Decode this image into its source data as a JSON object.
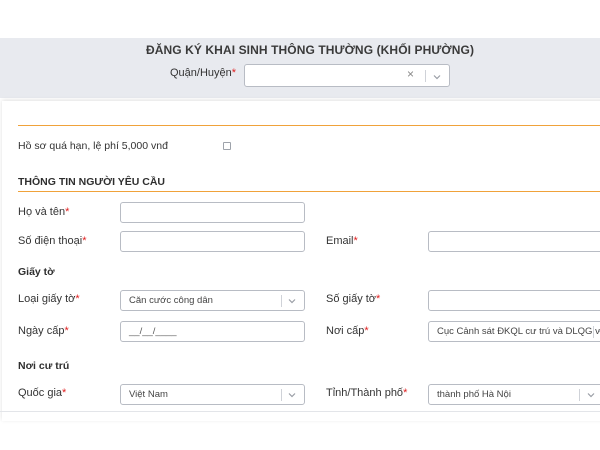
{
  "header": {
    "title": "ĐĂNG KÝ KHAI SINH THÔNG THƯỜNG (KHỐI PHƯỜNG)",
    "district_label": "Quận/Huyện",
    "district_value": "",
    "clear_glyph": "×"
  },
  "form": {
    "late_fee_label": "Hồ sơ quá hạn, lệ phí 5,000 vnđ",
    "requester_section": "THÔNG TIN NGƯỜI YÊU CẦU",
    "full_name_label": "Họ và tên",
    "phone_label": "Số điện thoại",
    "email_label": "Email",
    "documents_section": "Giấy tờ",
    "doc_type_label": "Loại giấy tờ",
    "doc_type_value": "Căn cước công dân",
    "doc_number_label": "Số giấy tờ",
    "issue_date_label": "Ngày cấp",
    "issue_date_value": "__/__/____",
    "issue_place_label": "Nơi cấp",
    "issue_place_value": "Cục Cảnh sát ĐKQL cư trú và DLQG v...",
    "residence_section": "Nơi cư trú",
    "country_label": "Quốc gia",
    "country_value": "Việt Nam",
    "province_label": "Tỉnh/Thành phố",
    "province_value": "thành phố Hà Nội",
    "required_mark": "*"
  },
  "colors": {
    "accent_orange": "#f0a23a",
    "required_red": "#e02020",
    "header_band": "#e8eaef"
  },
  "icons": {
    "clear": "clear-icon",
    "chevron": "chevron-down-icon",
    "checkbox": "checkbox"
  }
}
